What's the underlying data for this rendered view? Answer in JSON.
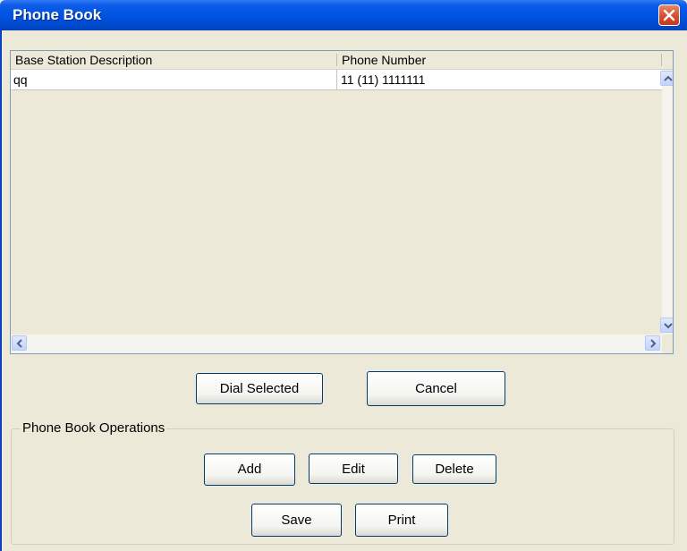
{
  "window": {
    "title": "Phone Book"
  },
  "table": {
    "columns": [
      "Base Station Description",
      "Phone Number"
    ],
    "rows": [
      {
        "description": "qq",
        "phone": "11 (11) 1111111"
      }
    ]
  },
  "actions": {
    "dial_label": "Dial Selected",
    "cancel_label": "Cancel"
  },
  "operations": {
    "group_label": "Phone Book Operations",
    "add_label": "Add",
    "edit_label": "Edit",
    "delete_label": "Delete",
    "save_label": "Save",
    "print_label": "Print"
  },
  "icons": {
    "close": "close-icon",
    "scroll_up": "scroll-up-arrow-icon",
    "scroll_down": "scroll-down-arrow-icon",
    "scroll_left": "scroll-left-arrow-icon",
    "scroll_right": "scroll-right-arrow-icon"
  },
  "colors": {
    "titlebar": "#0054E3",
    "close_button": "#D24B2A",
    "window_bg": "#ECE9D8",
    "button_border": "#003C74"
  }
}
